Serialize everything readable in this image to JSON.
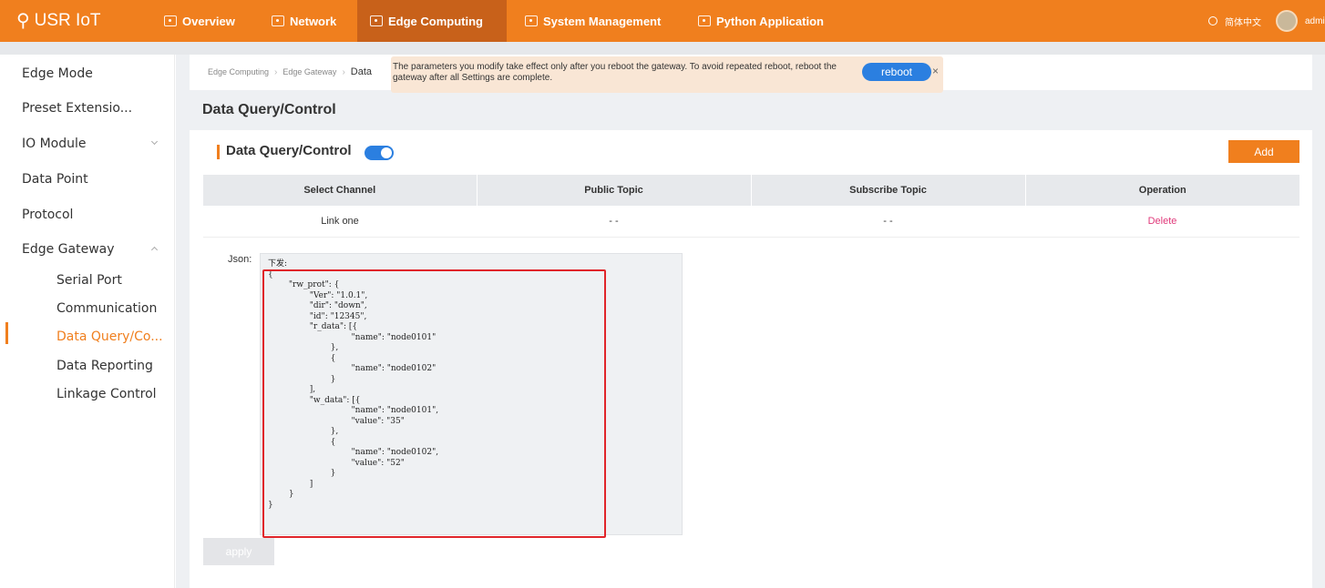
{
  "brand": {
    "name": "USR IoT",
    "icon": "person-logo-icon"
  },
  "nav": [
    {
      "label": "Overview",
      "icon": "frame-icon",
      "active": false
    },
    {
      "label": "Network",
      "icon": "frame-icon",
      "active": false
    },
    {
      "label": "Edge Computing",
      "icon": "frame-icon",
      "active": true
    },
    {
      "label": "System Management",
      "icon": "frame-icon",
      "active": false
    },
    {
      "label": "Python Application",
      "icon": "frame-icon",
      "active": false
    }
  ],
  "topright": {
    "language": "简体中文",
    "user": "admin"
  },
  "sidebar": {
    "items": [
      {
        "label": "Edge Mode"
      },
      {
        "label": "Preset Extensio..."
      },
      {
        "label": "IO Module"
      },
      {
        "label": "Data Point"
      },
      {
        "label": "Protocol"
      },
      {
        "label": "Edge Gateway"
      }
    ],
    "subitems": [
      {
        "label": "Serial Port"
      },
      {
        "label": "Communication"
      },
      {
        "label": "Data Query/Co...",
        "active": true
      },
      {
        "label": "Data Reporting"
      },
      {
        "label": "Linkage Control"
      }
    ]
  },
  "breadcrumb": {
    "level1": "Edge Computing",
    "level2": "Edge Gateway",
    "current": "Data"
  },
  "notice": {
    "text": "The parameters you modify take effect only after you reboot the gateway. To avoid repeated reboot, reboot the gateway after all Settings are complete.",
    "button": "reboot"
  },
  "page": {
    "section_title": "Data Query/Control",
    "card_title": "Data Query/Control",
    "toggle_on": true,
    "add_label": "Add"
  },
  "table": {
    "headers": [
      "Select Channel",
      "Public Topic",
      "Subscribe Topic",
      "Operation"
    ],
    "rows": [
      {
        "channel": "Link one",
        "public_topic": "- -",
        "subscribe_topic": "- -",
        "operation": "Delete"
      }
    ]
  },
  "json_editor": {
    "label": "Json:",
    "content": "下发:\n{\n        \"rw_prot\": {\n                \"Ver\": \"1.0.1\",\n                \"dir\": \"down\",\n                \"id\": \"12345\",\n                \"r_data\": [{\n                                \"name\": \"node0101\"\n                        },\n                        {\n                                \"name\": \"node0102\"\n                        }\n                ],\n                \"w_data\": [{\n                                \"name\": \"node0101\",\n                                \"value\": \"35\"\n                        },\n                        {\n                                \"name\": \"node0102\",\n                                \"value\": \"52\"\n                        }\n                ]\n        }\n}"
  },
  "apply_label": "apply",
  "colors": {
    "accent": "#f07f1e",
    "primary_blue": "#2b7fe0",
    "delete_pink": "#e0397a",
    "highlight_red": "#e0252a"
  }
}
